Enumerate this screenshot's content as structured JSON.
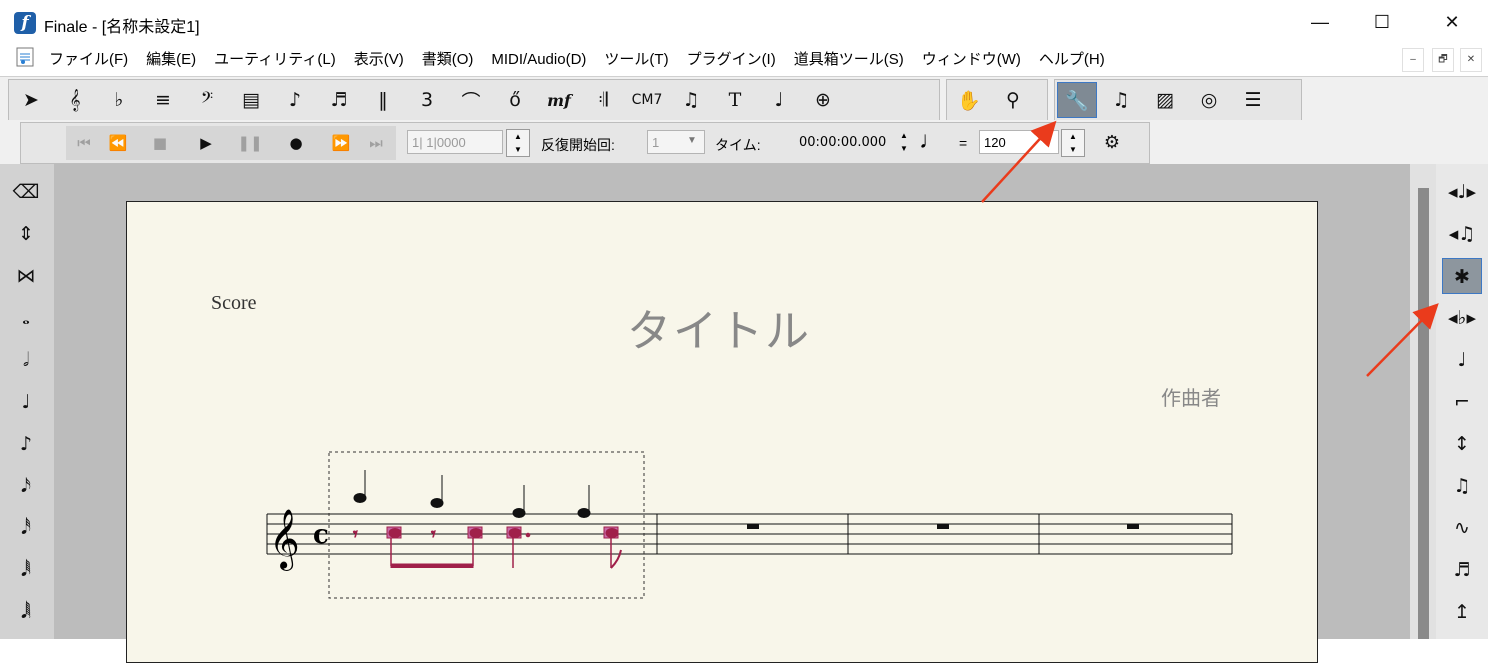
{
  "window": {
    "app_icon_letter": "f",
    "title": "Finale - [名称未設定1]",
    "minimize": "—",
    "maximize": "☐",
    "close": "✕"
  },
  "menu": {
    "items": [
      "ファイル(F)",
      "編集(E)",
      "ユーティリティ(L)",
      "表示(V)",
      "書類(O)",
      "MIDI/Audio(D)",
      "ツール(T)",
      "プラグイン(I)",
      "道具箱ツール(S)",
      "ウィンドウ(W)",
      "ヘルプ(H)"
    ],
    "doc_minimize": "–",
    "doc_restore": "🗗",
    "doc_close": "✕"
  },
  "main_tools": [
    {
      "name": "selection-tool",
      "icon": "arrow-icon"
    },
    {
      "name": "staff-tool",
      "icon": "treble-staff-icon"
    },
    {
      "name": "key-signature-tool",
      "icon": "key-signature-icon"
    },
    {
      "name": "time-signature-tool",
      "icon": "time-signature-icon"
    },
    {
      "name": "clef-tool",
      "icon": "bass-clef-icon"
    },
    {
      "name": "measure-tool",
      "icon": "measure-icon"
    },
    {
      "name": "simple-entry-tool",
      "icon": "eighth-note-icon"
    },
    {
      "name": "speedy-entry-tool",
      "icon": "speedy-note-icon"
    },
    {
      "name": "articulation-tool",
      "icon": "articulation-icon"
    },
    {
      "name": "tuplet-tool",
      "icon": "tuplet-icon"
    },
    {
      "name": "smart-shape-tool",
      "icon": "slur-icon"
    },
    {
      "name": "expression-tool",
      "icon": "expression-icon"
    },
    {
      "name": "dynamic-tool",
      "icon": "mf-icon"
    },
    {
      "name": "repeat-tool",
      "icon": "repeat-icon"
    },
    {
      "name": "chord-tool",
      "icon": "chord-icon"
    },
    {
      "name": "lyrics-tool",
      "icon": "lyrics-icon"
    },
    {
      "name": "text-tool",
      "icon": "text-icon"
    },
    {
      "name": "resize-tool",
      "icon": "resize-notes-icon"
    },
    {
      "name": "page-layout-tool",
      "icon": "page-layout-icon"
    }
  ],
  "tool_labels": {
    "mf": "mf",
    "chord": "CM7",
    "tuplet": "3",
    "text": "T"
  },
  "view_tools": [
    {
      "name": "hand-grabber-tool",
      "icon": "hand-icon"
    },
    {
      "name": "zoom-tool",
      "icon": "magnifier-icon"
    }
  ],
  "utility_tools": [
    {
      "name": "special-tools-tool",
      "icon": "wrench-icon",
      "active": true
    },
    {
      "name": "playback-tool",
      "icon": "beamed-notes-icon"
    },
    {
      "name": "graphics-tool",
      "icon": "add-image-icon"
    },
    {
      "name": "midi-tool",
      "icon": "midi-icon"
    },
    {
      "name": "score-manager-tool",
      "icon": "score-manager-icon"
    }
  ],
  "playback": {
    "measure_position": "1|  1|0000",
    "repeat_start_label": "反復開始回:",
    "repeat_start_value": "1",
    "time_label": "タイム:",
    "time_value": "00:00:00.000",
    "equals": "=",
    "tempo": "120"
  },
  "left_palette": [
    {
      "name": "eraser-icon"
    },
    {
      "name": "drag-note-icon"
    },
    {
      "name": "tie-icon"
    },
    {
      "name": "whole-note-icon"
    },
    {
      "name": "half-note-icon"
    },
    {
      "name": "quarter-note-icon"
    },
    {
      "name": "eighth-note-icon"
    },
    {
      "name": "sixteenth-note-icon"
    },
    {
      "name": "thirty-second-note-icon"
    },
    {
      "name": "sixty-fourth-note-icon"
    },
    {
      "name": "hundred-twenty-eighth-note-icon"
    }
  ],
  "right_palette": [
    {
      "name": "stem-flip-icon"
    },
    {
      "name": "stem-split-icon"
    },
    {
      "name": "stem-slash-icon",
      "active": true
    },
    {
      "name": "beam-break-icon"
    },
    {
      "name": "stem-up-icon"
    },
    {
      "name": "flag-icon"
    },
    {
      "name": "beam-angle-icon"
    },
    {
      "name": "beam-extend-icon"
    },
    {
      "name": "beam-flip-icon"
    },
    {
      "name": "triplet-beam-icon"
    },
    {
      "name": "beam-slope-icon"
    }
  ],
  "score": {
    "label": "Score",
    "title": "タイトル",
    "composer": "作曲者",
    "time_signature": "c"
  },
  "annotations": {
    "arrow_color": "#ea3b1c"
  },
  "colors": {
    "accent": "#3d78c4",
    "selected_note": "#a0204a",
    "page_bg": "#f8f6ea"
  }
}
